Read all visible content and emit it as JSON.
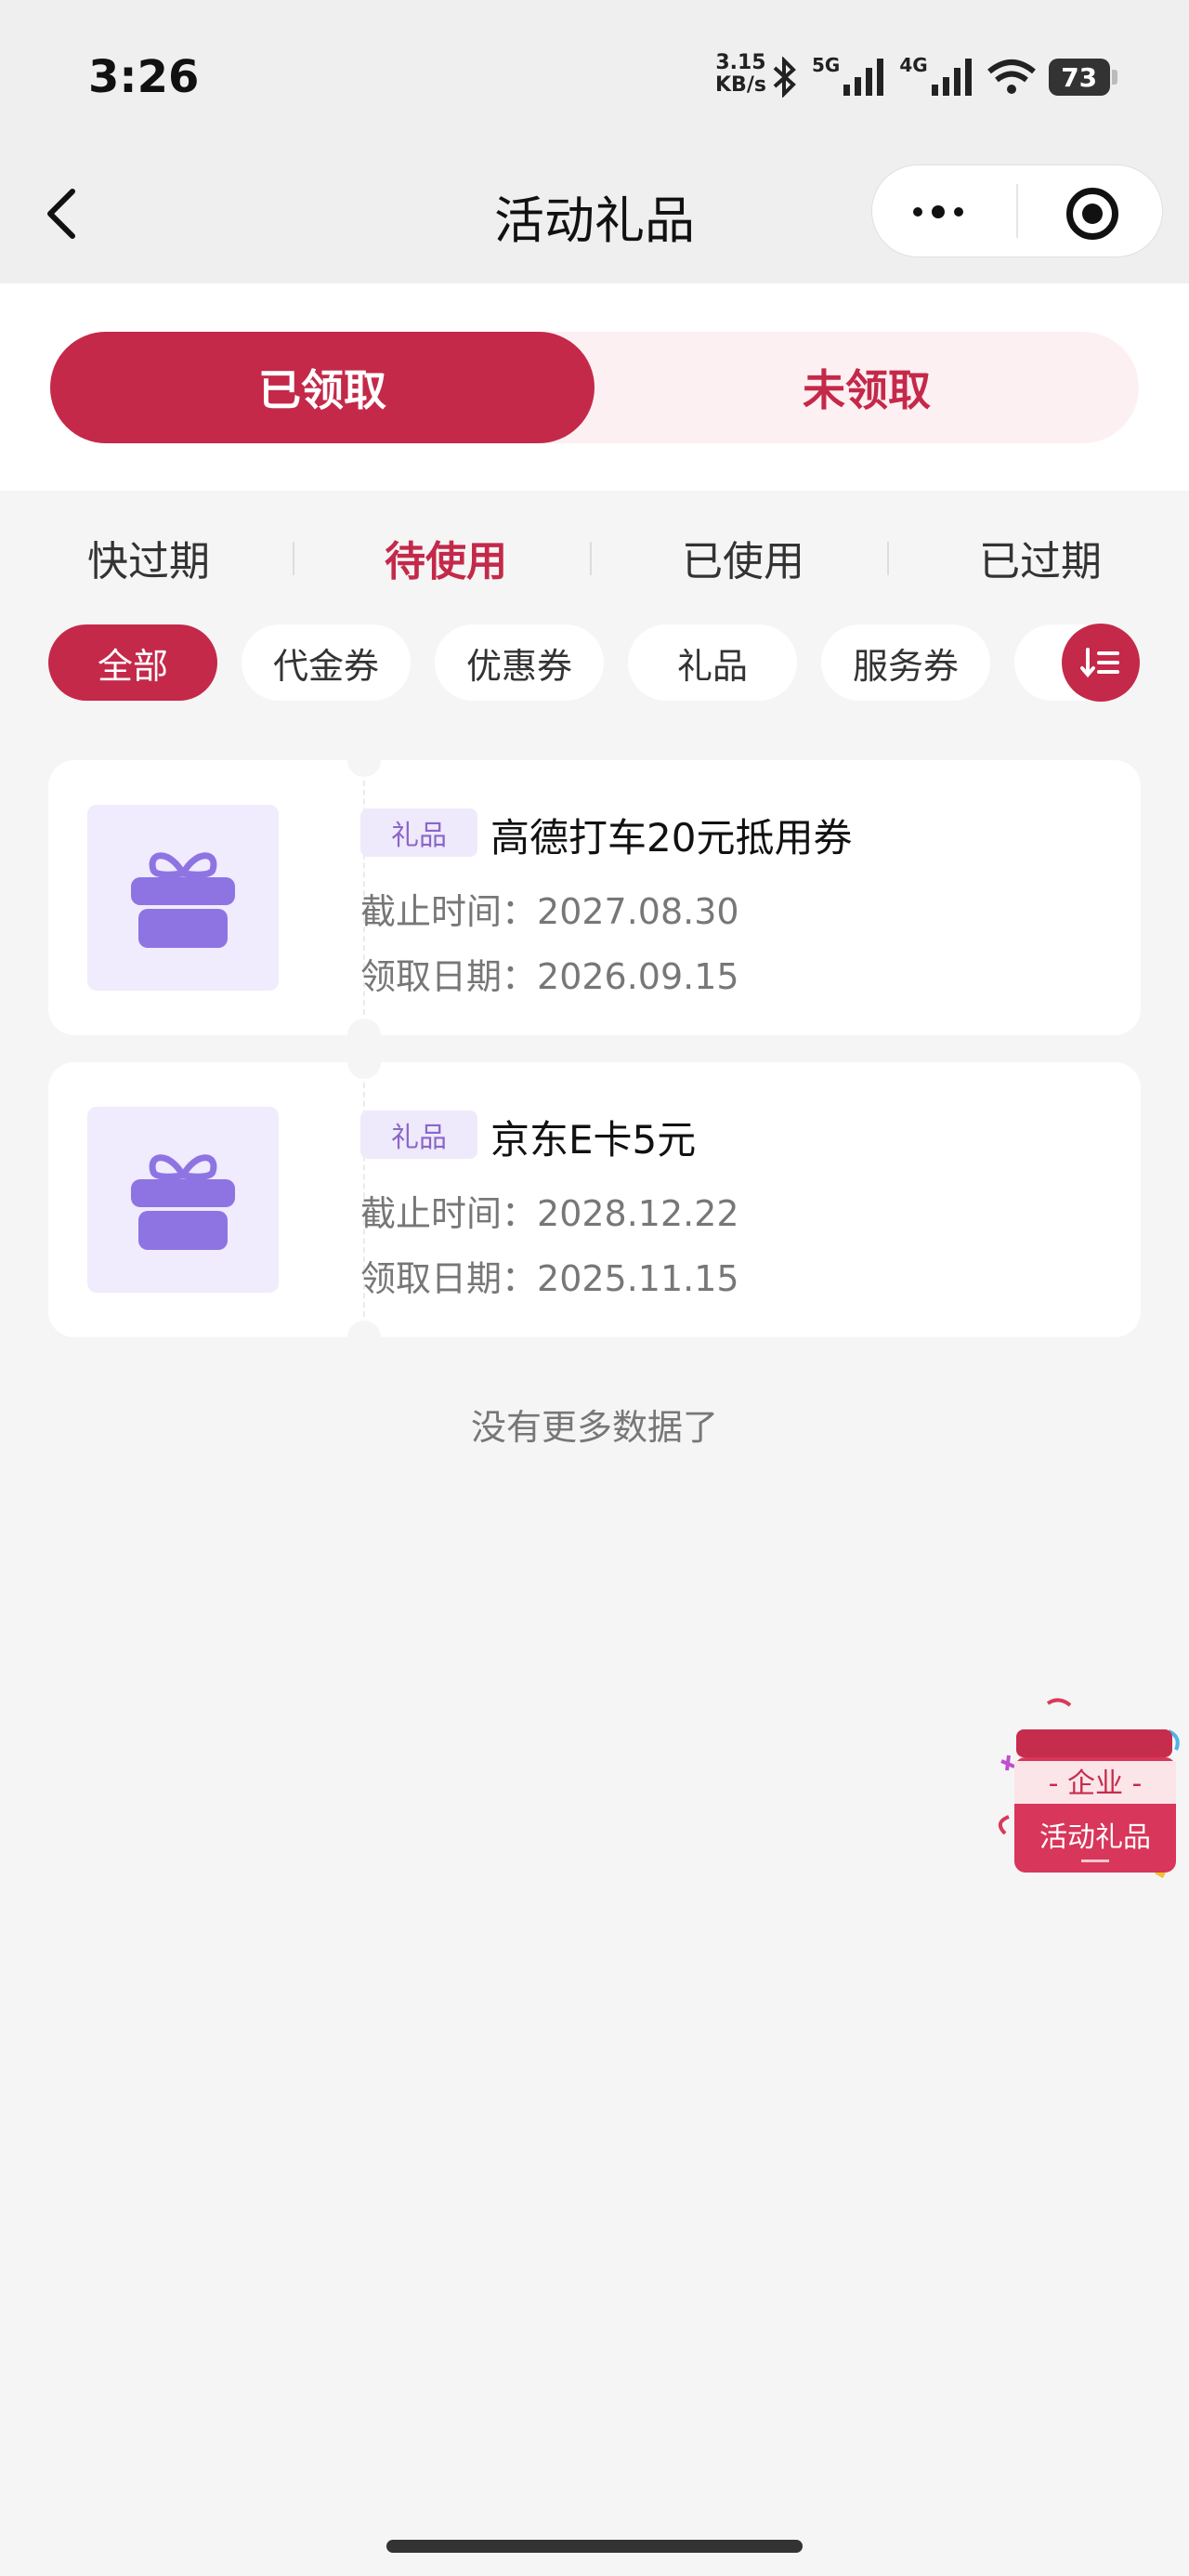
{
  "status_bar": {
    "time": "3:26",
    "net_speed_value": "3.15",
    "net_speed_unit": "KB/s",
    "net1": "5G",
    "net2": "4G",
    "battery": "73"
  },
  "nav": {
    "title": "活动礼品"
  },
  "segment": {
    "active": "已领取",
    "inactive": "未领取"
  },
  "status_tabs": [
    "快过期",
    "待使用",
    "已使用",
    "已过期"
  ],
  "active_status_tab": "待使用",
  "filters": [
    "全部",
    "代金券",
    "优惠券",
    "礼品",
    "服务券"
  ],
  "active_filter": "全部",
  "colors": {
    "primary": "#c4294a",
    "tag_bg": "#efe9fc",
    "gift_icon": "#8e74e3"
  },
  "cards": [
    {
      "tag": "礼品",
      "title": "高德打车20元抵用券",
      "deadline_label": "截止时间：",
      "deadline": "2027.08.30",
      "received_label": "领取日期：",
      "received": "2026.09.15",
      "icon": "gift-icon"
    },
    {
      "tag": "礼品",
      "title": "京东E卡5元",
      "deadline_label": "截止时间：",
      "deadline": "2028.12.22",
      "received_label": "领取日期：",
      "received": "2025.11.15",
      "icon": "gift-icon"
    }
  ],
  "footer_text": "没有更多数据了",
  "float_badge": {
    "line1": "- 企业 -",
    "line2": "活动礼品"
  }
}
